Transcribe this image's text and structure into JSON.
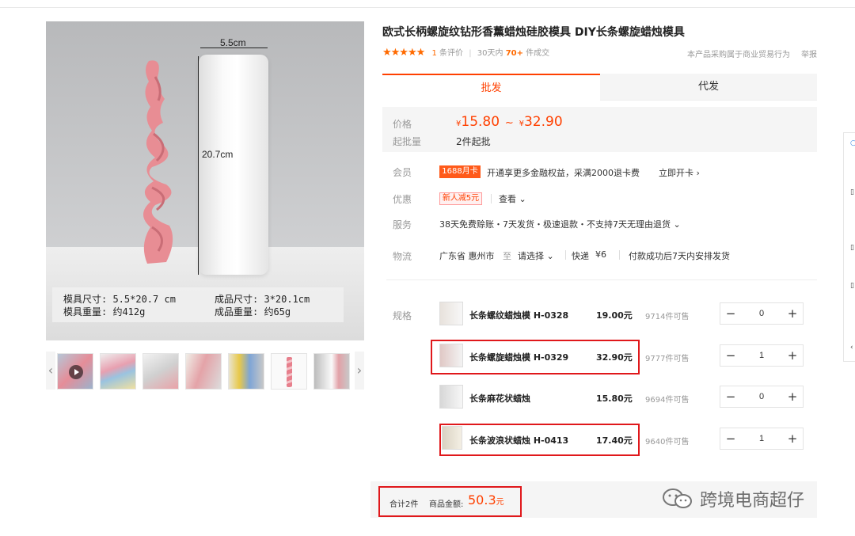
{
  "product": {
    "title": "欧式长柄螺旋纹钻形香薰蜡烛硅胶模具 DIY长条螺旋蜡烛模具",
    "stars": "★★★★★",
    "review_count": "1",
    "review_label": "条评价",
    "sales_period": "30天内",
    "sales_count": "70+",
    "sales_label": "件成交",
    "notice": "本产品采购属于商业贸易行为",
    "report": "举报"
  },
  "image": {
    "dim_width": "5.5cm",
    "dim_height": "20.7cm",
    "spec_line1_a": "模具尺寸: 5.5*20.7 cm",
    "spec_line1_b": "成品尺寸: 3*20.1cm",
    "spec_line2_a": "模具重量: 约412g",
    "spec_line2_b": "成品重量: 约65g",
    "prev": "‹",
    "next": "›"
  },
  "tabs": {
    "wholesale": "批发",
    "dropship": "代发"
  },
  "price": {
    "label": "价格",
    "yen": "¥",
    "low": "15.80",
    "tilde": "~",
    "high": "32.90",
    "moq_label": "起批量",
    "moq": "2件起批"
  },
  "member": {
    "label": "会员",
    "badge": "1688月卡",
    "text": "开通享更多金融权益，采满2000退卡费",
    "action": "立即开卡 ›"
  },
  "promo": {
    "label": "优惠",
    "badge": "新人减5元",
    "action": "查看 ⌄"
  },
  "service": {
    "label": "服务",
    "text": "38天免费赊账・7天发货・极速退款・不支持7天无理由退货 ⌄"
  },
  "logistics": {
    "label": "物流",
    "origin": "广东省 惠州市",
    "to": "至",
    "dest": "请选择 ⌄",
    "express": "快递",
    "fee": "¥6",
    "ship": "付款成功后7天内安排发货"
  },
  "spec": {
    "label": "规格",
    "items": [
      {
        "name": "长条螺纹蜡烛模 H-0328",
        "price": "19.00元",
        "stock": "9714件可售",
        "qty": "0"
      },
      {
        "name": "长条螺旋蜡烛模 H-0329",
        "price": "32.90元",
        "stock": "9777件可售",
        "qty": "1"
      },
      {
        "name": "长条麻花状蜡烛",
        "price": "15.80元",
        "stock": "9694件可售",
        "qty": "0"
      },
      {
        "name": "长条波浪状蜡烛 H-0413",
        "price": "17.40元",
        "stock": "9640件可售",
        "qty": "1"
      }
    ],
    "minus": "−",
    "plus": "+"
  },
  "summary": {
    "count": "合计2件",
    "amount_label": "商品金额:",
    "amount": "50.3",
    "unit": "元"
  },
  "watermark": {
    "text": "跨境电商超仔"
  },
  "colors": {
    "accent": "#ff4000",
    "frame": "#e0181b",
    "star": "#ff6a00"
  }
}
